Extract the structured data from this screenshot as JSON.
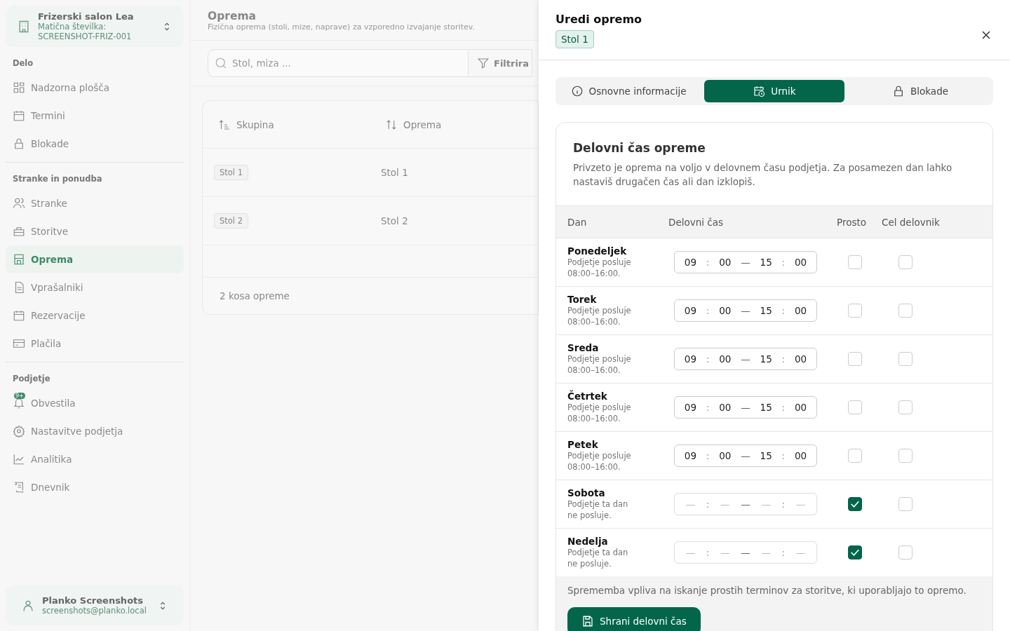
{
  "sidebar": {
    "company": {
      "name": "Frizerski salon Lea",
      "id_label": "Matična številka:",
      "id_value": "SCREENSHOT-FRIZ-001"
    },
    "sections": [
      {
        "title": "Delo",
        "items": [
          {
            "label": "Nadzorna plošča",
            "selected": false
          },
          {
            "label": "Termini",
            "selected": false
          },
          {
            "label": "Blokade",
            "selected": false
          }
        ]
      },
      {
        "title": "Stranke in ponudba",
        "items": [
          {
            "label": "Stranke",
            "selected": false
          },
          {
            "label": "Storitve",
            "selected": false
          },
          {
            "label": "Oprema",
            "selected": true
          },
          {
            "label": "Vprašalniki",
            "selected": false
          },
          {
            "label": "Rezervacije",
            "selected": false
          },
          {
            "label": "Plačila",
            "selected": false
          }
        ]
      },
      {
        "title": "Podjetje",
        "items": [
          {
            "label": "Obvestila",
            "selected": false,
            "badge": "9+"
          },
          {
            "label": "Nastavitve podjetja",
            "selected": false
          },
          {
            "label": "Analitika",
            "selected": false
          },
          {
            "label": "Dnevnik",
            "selected": false
          }
        ]
      }
    ],
    "user": {
      "name": "Planko Screenshots",
      "email": "screenshots@planko.local"
    }
  },
  "page": {
    "title": "Oprema",
    "subtitle": "Fizična oprema (stoli, mize, naprave) za vzporedno izvajanje storitev.",
    "search": {
      "placeholder": "Stol, miza ..."
    },
    "filter_label": "Filtrira",
    "table": {
      "columns": [
        "Skupina",
        "Oprema"
      ],
      "rows": [
        {
          "group": "Stol 1",
          "equipment": "Stol 1"
        },
        {
          "group": "Stol 2",
          "equipment": "Stol 2"
        }
      ],
      "footer": "2 kosa opreme"
    }
  },
  "drawer": {
    "title": "Uredi opremo",
    "badge": "Stol 1",
    "tabs": [
      {
        "label": "Osnovne informacije",
        "selected": false
      },
      {
        "label": "Urnik",
        "selected": true
      },
      {
        "label": "Blokade",
        "selected": false
      }
    ],
    "schedule": {
      "title": "Delovni čas opreme",
      "description": "Privzeto je oprema na voljo v delovnem času podjetja. Za posamezen dan lahko nastaviš drugačen čas ali dan izklopiš.",
      "columns": [
        "Dan",
        "Delovni čas",
        "Prosto",
        "Cel delovnik"
      ],
      "time_separator": ":",
      "range_separator": "—",
      "days": [
        {
          "name": "Ponedeljek",
          "note": "Podjetje posluje 08:00–16:00.",
          "time": [
            "09",
            "00",
            "15",
            "00"
          ],
          "free": false,
          "full_day": false
        },
        {
          "name": "Torek",
          "note": "Podjetje posluje 08:00–16:00.",
          "time": [
            "09",
            "00",
            "15",
            "00"
          ],
          "free": false,
          "full_day": false
        },
        {
          "name": "Sreda",
          "note": "Podjetje posluje 08:00–16:00.",
          "time": [
            "09",
            "00",
            "15",
            "00"
          ],
          "free": false,
          "full_day": false
        },
        {
          "name": "Četrtek",
          "note": "Podjetje posluje 08:00–16:00.",
          "time": [
            "09",
            "00",
            "15",
            "00"
          ],
          "free": false,
          "full_day": false
        },
        {
          "name": "Petek",
          "note": "Podjetje posluje 08:00–16:00.",
          "time": [
            "09",
            "00",
            "15",
            "00"
          ],
          "free": false,
          "full_day": false
        },
        {
          "name": "Sobota",
          "note": "Podjetje ta dan ne posluje.",
          "time": [
            "—",
            "—",
            "—",
            "—"
          ],
          "free": true,
          "full_day": false
        },
        {
          "name": "Nedelja",
          "note": "Podjetje ta dan ne posluje.",
          "time": [
            "—",
            "—",
            "—",
            "—"
          ],
          "free": true,
          "full_day": false
        }
      ],
      "footer_note": "Sprememba vpliva na iskanje prostih terminov za storitve, ki uporabljajo to opremo.",
      "save_label": "Shrani delovni čas"
    }
  }
}
